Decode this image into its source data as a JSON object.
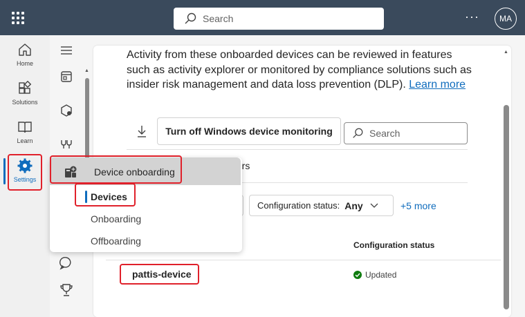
{
  "topbar": {
    "search_placeholder": "Search",
    "more_label": "···",
    "avatar_initials": "MA"
  },
  "rail": {
    "items": [
      {
        "label": "Home",
        "icon": "home-icon"
      },
      {
        "label": "Solutions",
        "icon": "solutions-icon"
      },
      {
        "label": "Learn",
        "icon": "learn-icon"
      },
      {
        "label": "Settings",
        "icon": "gear-icon",
        "active": true
      }
    ]
  },
  "main": {
    "description": "Activity from these onboarded devices can be reviewed in features such as activity explorer or monitored by compliance solutions such as insider risk management and data loss prevention (DLP).",
    "learn_more": "Learn more",
    "toggle_button": "Turn off Windows device monitoring",
    "search_placeholder": "Search",
    "filters_label": "ters",
    "config_filter_label": "Configuration status:",
    "config_filter_value": "Any",
    "more_filters": "+5 more",
    "column_header": "Configuration status",
    "rows": [
      {
        "name": "pattis-device",
        "status": "Updated"
      }
    ]
  },
  "flyout": {
    "header": "Device onboarding",
    "items": [
      {
        "label": "Devices",
        "active": true
      },
      {
        "label": "Onboarding"
      },
      {
        "label": "Offboarding"
      }
    ]
  },
  "colors": {
    "accent": "#0f6cbd",
    "topbar": "#3a4a5c",
    "callout": "#e0202a",
    "success": "#107c10"
  }
}
